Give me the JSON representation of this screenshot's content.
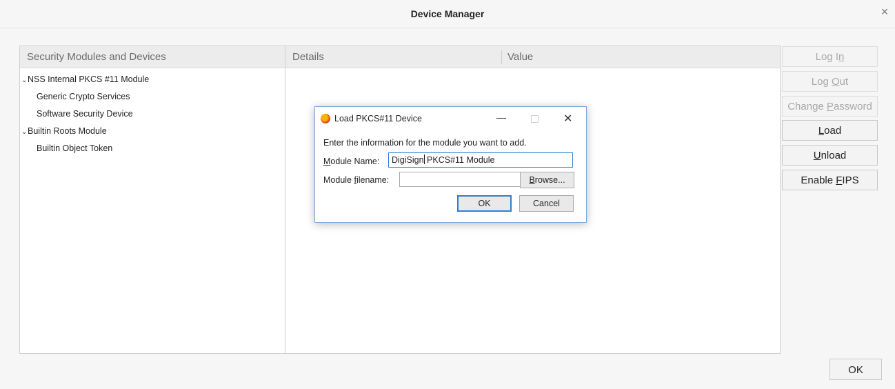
{
  "window": {
    "title": "Device Manager",
    "close_glyph": "×"
  },
  "left_panel": {
    "header": "Security Modules and Devices",
    "tree": [
      {
        "label": "NSS Internal PKCS #11 Module",
        "expanded": true
      },
      {
        "label": "Generic Crypto Services"
      },
      {
        "label": "Software Security Device"
      },
      {
        "label": "Builtin Roots Module",
        "expanded": true
      },
      {
        "label": "Builtin Object Token"
      }
    ]
  },
  "right_panel": {
    "col_details": "Details",
    "col_value": "Value"
  },
  "side_buttons": {
    "log_in": {
      "pre": "Log I",
      "key": "n",
      "post": ""
    },
    "log_out": {
      "pre": "Log ",
      "key": "O",
      "post": "ut"
    },
    "change_password": {
      "pre": "Change ",
      "key": "P",
      "post": "assword"
    },
    "load": {
      "pre": "",
      "key": "L",
      "post": "oad"
    },
    "unload": {
      "pre": "",
      "key": "U",
      "post": "nload"
    },
    "enable_fips": {
      "pre": "Enable ",
      "key": "F",
      "post": "IPS"
    }
  },
  "main_ok": "OK",
  "dialog": {
    "title": "Load PKCS#11 Device",
    "min_glyph": "—",
    "close_glyph": "✕",
    "message": "Enter the information for the module you want to add.",
    "name_label": {
      "pre": "",
      "key": "M",
      "post": "odule Name:"
    },
    "name_value_before_caret": "DigiSign",
    "name_value_after_caret": " PKCS#11 Module",
    "file_label": {
      "pre": "Module ",
      "key": "f",
      "post": "ilename:"
    },
    "file_value": "",
    "browse": {
      "pre": "",
      "key": "B",
      "post": "rowse..."
    },
    "ok": "OK",
    "cancel": "Cancel"
  },
  "colors": {
    "accent": "#2f7fd4",
    "disabled_text": "#a8a8a8"
  }
}
